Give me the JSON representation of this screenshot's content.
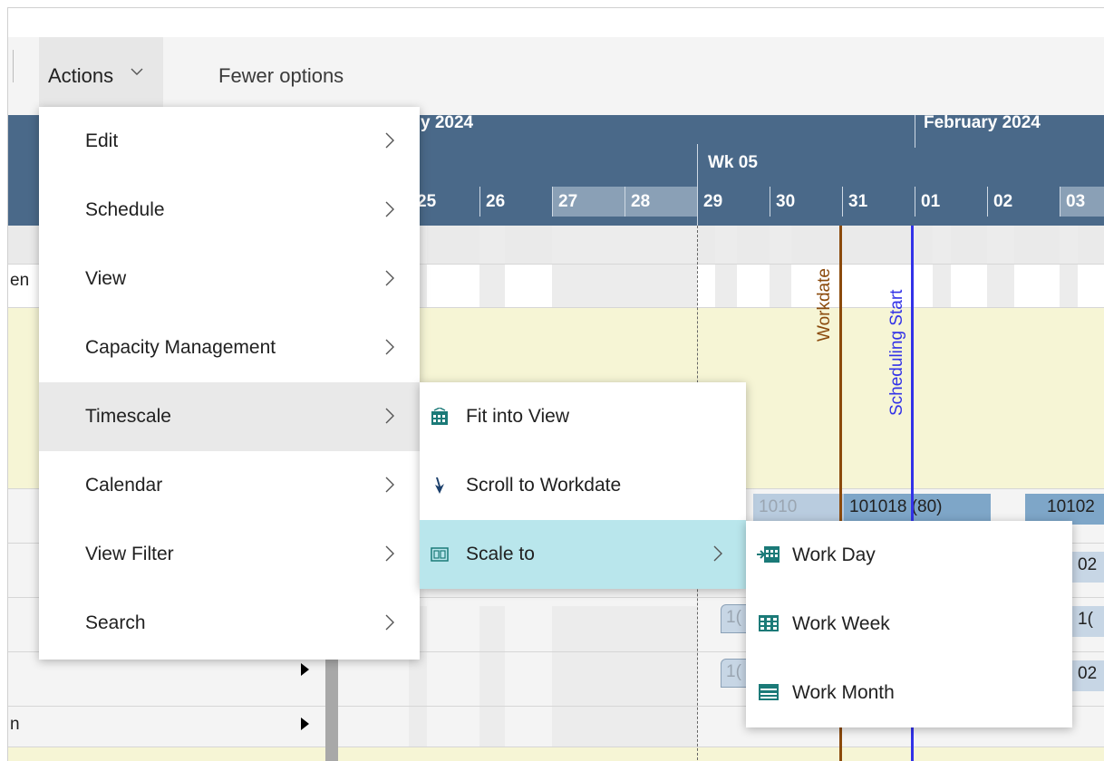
{
  "toolbar": {
    "actions_label": "Actions",
    "fewer_options_label": "Fewer options"
  },
  "gantt": {
    "month_left": "y 2024",
    "month_right": "February 2024",
    "week": "Wk 05",
    "days": [
      "25",
      "26",
      "27",
      "28",
      "29",
      "30",
      "31",
      "01",
      "02",
      "03"
    ],
    "workdate_label": "Workdate",
    "scheduling_start_label": "Scheduling Start",
    "left_text_1": "en",
    "left_text_2": "n",
    "bar_text_left": "1010",
    "bar_text_mid": "101018 (80)",
    "bar_text_right": "10102",
    "chip_text_1": "1(",
    "chip_text_2": "1(",
    "right_text_1": "02",
    "right_text_2": "1(",
    "right_text_3": "02"
  },
  "menu": {
    "items": [
      {
        "label": "Edit"
      },
      {
        "label": "Schedule"
      },
      {
        "label": "View"
      },
      {
        "label": "Capacity Management"
      },
      {
        "label": "Timescale"
      },
      {
        "label": "Calendar"
      },
      {
        "label": "View Filter"
      },
      {
        "label": "Search"
      }
    ],
    "active_index": 4
  },
  "timescale_menu": {
    "items": [
      {
        "label": "Fit into View",
        "icon": "fit-into-view-icon"
      },
      {
        "label": "Scroll to Workdate",
        "icon": "scroll-down-arrow-icon"
      },
      {
        "label": "Scale to",
        "icon": "scale-to-icon"
      }
    ],
    "active_index": 2
  },
  "scale_menu": {
    "items": [
      {
        "label": "Work Day",
        "icon": "work-day-icon"
      },
      {
        "label": "Work Week",
        "icon": "work-week-icon"
      },
      {
        "label": "Work Month",
        "icon": "work-month-icon"
      }
    ]
  },
  "colors": {
    "header_bg": "#4a6989",
    "workdate_line": "#8b4a0c",
    "scheduling_line": "#3232e8",
    "active_submenu": "#b9e6ec",
    "task_bar": "#7ea6c8",
    "timeline_highlight": "#f6f5d5"
  }
}
